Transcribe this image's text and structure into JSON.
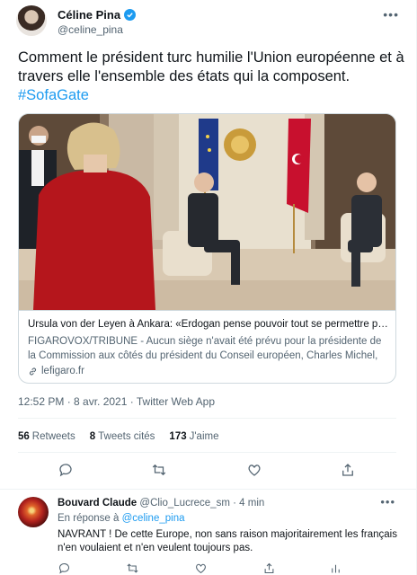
{
  "tweet": {
    "author_name": "Céline Pina",
    "author_handle": "@celine_pina",
    "verified": true,
    "text_main": "Comment le président turc humilie l'Union européenne et à travers elle l'ensemble des états qui la composent.",
    "hashtag": "#SofaGate",
    "card": {
      "title": "Ursula von der Leyen à Ankara: «Erdogan pense pouvoir tout se permettre par…",
      "description": "FIGAROVOX/TRIBUNE - Aucun siège n'avait été prévu pour la présidente de la Commission aux côtés du président du Conseil européen, Charles Michel, et d…",
      "domain": "lefigaro.fr"
    },
    "meta": "12:52 PM · 8 avr. 2021 · Twitter Web App",
    "stats": {
      "retweets_count": "56",
      "retweets_label": "Retweets",
      "quotes_count": "8",
      "quotes_label": "Tweets cités",
      "likes_count": "173",
      "likes_label": "J'aime"
    }
  },
  "reply": {
    "author_name": "Bouvard Claude",
    "author_handle": "@Clio_Lucrece_sm",
    "time": "· 4 min",
    "reply_prefix": "En réponse à",
    "reply_to": "@celine_pina",
    "text": "NAVRANT ! De cette Europe, non sans raison majoritairement  les français n'en voulaient  et n'en veulent toujours pas."
  },
  "colors": {
    "accent": "#1d9bf0",
    "secondary_text": "#536471",
    "border": "#cfd9de"
  },
  "icons": [
    "more-icon",
    "verified-icon",
    "reply-icon",
    "retweet-icon",
    "like-icon",
    "share-icon",
    "link-icon",
    "analytics-icon"
  ]
}
